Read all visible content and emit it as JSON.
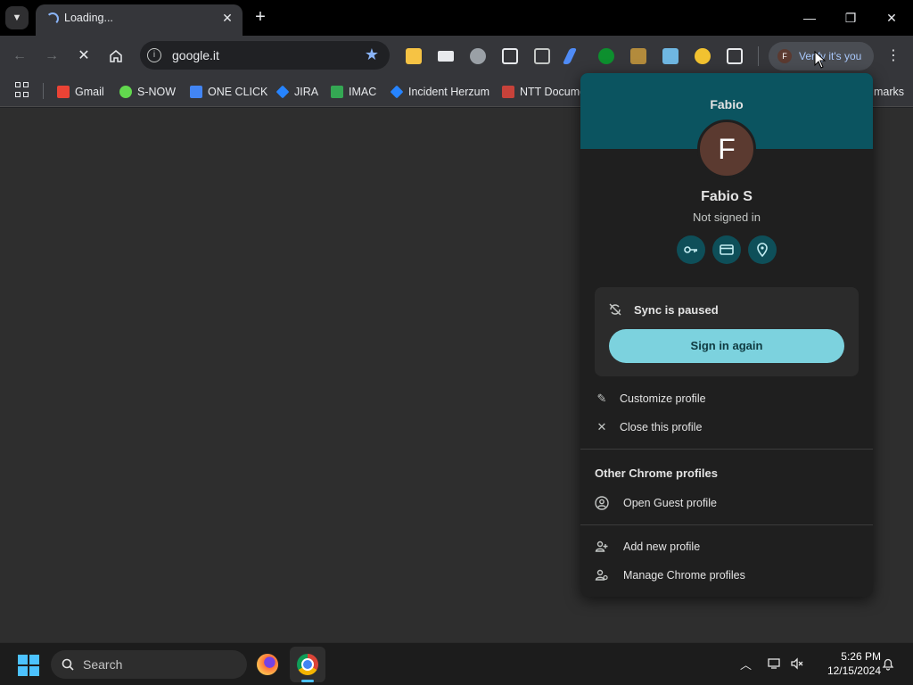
{
  "tab": {
    "title": "Loading...",
    "close": "✕"
  },
  "new_tab": "+",
  "window_controls": {
    "minimize": "—",
    "maximize": "❐",
    "close": "✕"
  },
  "toolbar": {
    "url": "google.it",
    "verify_chip": {
      "avatar_letter": "F",
      "label": "Verify it's you"
    }
  },
  "bookmarks": [
    {
      "label": "Gmail",
      "icon": "gmail-icon",
      "color": "#ea4335"
    },
    {
      "label": "S-NOW",
      "icon": "servicenow-icon",
      "color": "#62d84e"
    },
    {
      "label": "ONE CLICK",
      "icon": "oneclick-icon",
      "color": "#4285f4"
    },
    {
      "label": "JIRA",
      "icon": "jira-icon",
      "color": "#2684ff"
    },
    {
      "label": "IMAC",
      "icon": "imac-icon",
      "color": "#34a853"
    },
    {
      "label": "Incident Herzum",
      "icon": "jira-icon",
      "color": "#2684ff"
    },
    {
      "label": "NTT Docume",
      "icon": "ntt-icon",
      "color": "#c7423a"
    }
  ],
  "bookmarks_overflow": "marks",
  "profile_menu": {
    "banner_name": "Fabio",
    "avatar_letter": "F",
    "full_name": "Fabio S",
    "status": "Not signed in",
    "sync_text": "Sync is paused",
    "sign_in_label": "Sign in again",
    "customize_label": "Customize profile",
    "close_profile_label": "Close this profile",
    "other_profiles_title": "Other Chrome profiles",
    "guest_label": "Open Guest profile",
    "add_profile_label": "Add new profile",
    "manage_profiles_label": "Manage Chrome profiles"
  },
  "taskbar": {
    "search_placeholder": "Search",
    "time": "5:26 PM",
    "date": "12/15/2024"
  },
  "colors": {
    "accent": "#7cd2de",
    "banner": "#0b5460",
    "avatar": "#5b3a30"
  }
}
